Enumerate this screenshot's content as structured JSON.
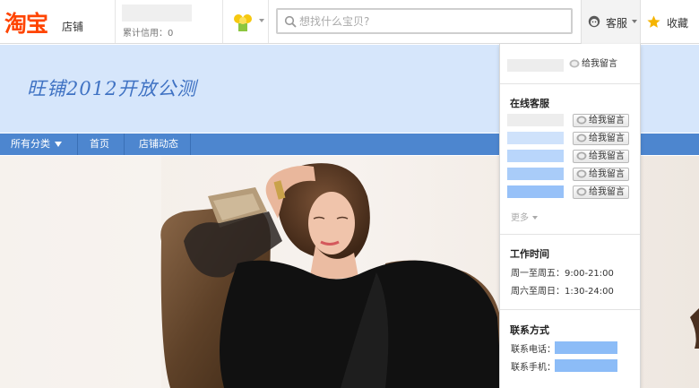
{
  "topbar": {
    "logo_main": "淘宝",
    "logo_sub": "店铺",
    "credit_text": "累计信用：0",
    "search_placeholder": "想找什么宝贝?",
    "kefu_label": "客服",
    "fav_label": "收藏"
  },
  "banner": {
    "title": "旺铺2012开放公测"
  },
  "nav": {
    "items": [
      "所有分类",
      "首页",
      "店铺动态"
    ]
  },
  "kefu_panel": {
    "top_button": "给我留言",
    "online_title": "在线客服",
    "agents": [
      {
        "button": "给我留言",
        "bar_color": "#ededed"
      },
      {
        "button": "给我留言",
        "bar_color": "#cfe2fb"
      },
      {
        "button": "给我留言",
        "bar_color": "#b9d6fb"
      },
      {
        "button": "给我留言",
        "bar_color": "#a9ccf9"
      },
      {
        "button": "给我留言",
        "bar_color": "#97c1f8"
      }
    ],
    "more_label": "更多",
    "hours_title": "工作时间",
    "hours": [
      "周一至周五：9:00-21:00",
      "周六至周日：1:30-24:00"
    ],
    "contact_title": "联系方式",
    "contact_phone_label": "联系电话：",
    "contact_mobile_label": "联系手机："
  },
  "colors": {
    "brand": "#ff4400",
    "banner_bg": "#d6e6fb",
    "banner_text": "#3f72c3",
    "nav_bg": "#4d86cf",
    "contact_bar": "#8cbcf7"
  }
}
